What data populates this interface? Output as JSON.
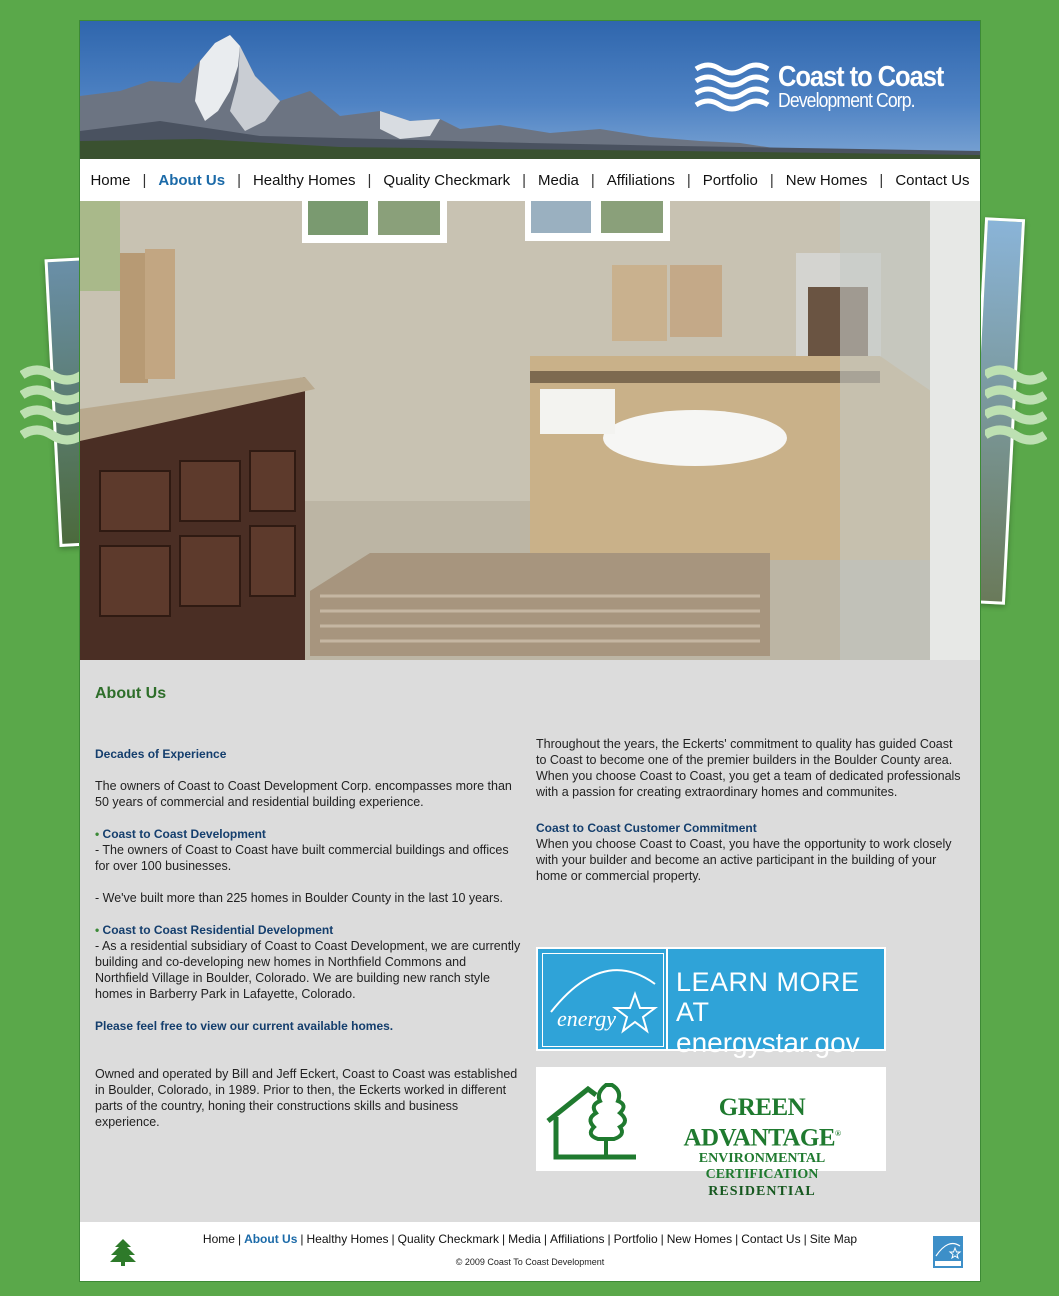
{
  "brand": {
    "title": "Coast to Coast",
    "subtitle": "Development Corp."
  },
  "nav": {
    "items": [
      {
        "label": "Home",
        "active": false
      },
      {
        "label": "About Us",
        "active": true
      },
      {
        "label": "Healthy Homes",
        "active": false
      },
      {
        "label": "Quality Checkmark",
        "active": false
      },
      {
        "label": "Media",
        "active": false
      },
      {
        "label": "Affiliations",
        "active": false
      },
      {
        "label": "Portfolio",
        "active": false
      },
      {
        "label": "New Homes",
        "active": false
      },
      {
        "label": "Contact Us",
        "active": false
      }
    ],
    "separator": "|"
  },
  "content": {
    "title": "About Us",
    "left": {
      "heading1": "Decades of Experience",
      "p1": "The owners of Coast to Coast Development Corp. encompasses more than 50 years of commercial and residential building experience.",
      "bullet": "•",
      "heading2": "Coast to Coast Development",
      "p2": "- The owners of Coast to Coast have built commercial buildings and offices for over 100 businesses.",
      "p3": "- We've built more than 225 homes in Boulder County in the last 10 years.",
      "heading3": "Coast to Coast Residential Development",
      "p4": "- As a residential subsidiary of Coast to Coast Development, we are currently building and co-developing new homes in Northfield Commons and Northfield Village in Boulder, Colorado. We are building new ranch style homes in Barberry Park in Lafayette, Colorado.",
      "link": "Please feel free to view our current available homes.",
      "p5": "Owned and operated by Bill and Jeff Eckert, Coast to Coast was established in Boulder, Colorado, in 1989. Prior to then, the Eckerts worked in different parts of the country, honing their constructions skills and business experience."
    },
    "right": {
      "p1": "Throughout the years, the Eckerts' commitment to quality has guided Coast to Coast to become one of the premier builders in the Boulder County area. When you choose Coast to Coast, you get a team of dedicated professionals with a passion for creating extraordinary homes and communites.",
      "heading": "Coast to Coast Customer Commitment",
      "p2": "When you choose Coast to Coast, you have the opportunity to work closely with your builder and become an active participant in the building of your home or commercial property."
    },
    "energy_star": {
      "logo_text": "energy",
      "line1": "LEARN MORE AT",
      "line2": "energystar.gov"
    },
    "green_advantage": {
      "line1": "GREEN ADVANTAGE",
      "line2": "ENVIRONMENTAL CERTIFICATION",
      "line3": "RESIDENTIAL",
      "mark": "®"
    }
  },
  "footer": {
    "items": [
      "Home",
      "About Us",
      "Healthy Homes",
      "Quality Checkmark",
      "Media",
      "Affiliations",
      "Portfolio",
      "New Homes",
      "Contact Us",
      "Site Map"
    ],
    "active": "About Us",
    "separator": "|",
    "copyright": "© 2009 Coast To Coast Development"
  },
  "colors": {
    "background": "#5aa84a",
    "header_blue": "#2f66ad",
    "nav_active": "#1b6aa8",
    "title_green": "#2e6e2a",
    "heading_navy": "#143e6d",
    "energy_blue": "#2fa3d8",
    "green_advantage": "#1f7a2f"
  }
}
